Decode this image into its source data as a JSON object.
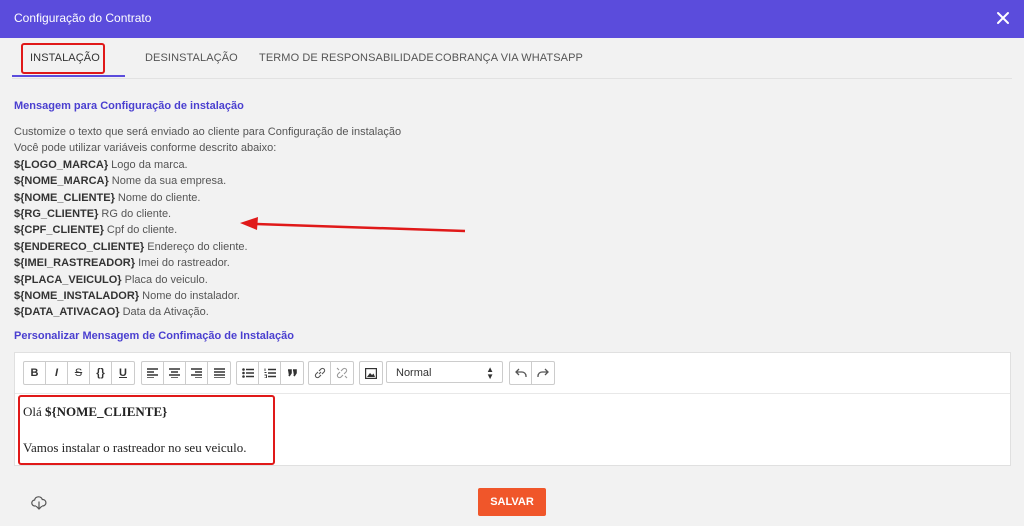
{
  "header": {
    "title": "Configuração do Contrato"
  },
  "tabs": [
    {
      "label": "INSTALAÇÃO"
    },
    {
      "label": "DESINSTALAÇÃO"
    },
    {
      "label": "TERMO DE RESPONSABILIDADE"
    },
    {
      "label": "COBRANÇA VIA WHATSAPP"
    }
  ],
  "section1": {
    "title": "Mensagem para Configuração de instalação",
    "intro1": "Customize o texto que será enviado ao cliente para Configuração de instalação",
    "intro2": "Você pode utilizar variáveis conforme descrito abaixo:",
    "variables": [
      {
        "name": "${LOGO_MARCA}",
        "desc": " Logo da marca."
      },
      {
        "name": "${NOME_MARCA}",
        "desc": " Nome da sua empresa."
      },
      {
        "name": "${NOME_CLIENTE}",
        "desc": " Nome do cliente."
      },
      {
        "name": "${RG_CLIENTE}",
        "desc": " RG do cliente."
      },
      {
        "name": "${CPF_CLIENTE}",
        "desc": " Cpf do cliente."
      },
      {
        "name": "${ENDERECO_CLIENTE}",
        "desc": " Endereço do cliente."
      },
      {
        "name": "${IMEI_RASTREADOR}",
        "desc": " Imei do rastreador."
      },
      {
        "name": "${PLACA_VEICULO}",
        "desc": " Placa do veiculo."
      },
      {
        "name": "${NOME_INSTALADOR}",
        "desc": " Nome do instalador."
      },
      {
        "name": "${DATA_ATIVACAO}",
        "desc": " Data da Ativação."
      }
    ]
  },
  "section2": {
    "title": "Personalizar Mensagem de Confimação de Instalação"
  },
  "toolbar": {
    "bold": "B",
    "italic": "I",
    "strike": "S",
    "code": "{}",
    "underline": "U",
    "format_select": "Normal"
  },
  "editor": {
    "line1_prefix": "Olá ",
    "line1_var": "${NOME_CLIENTE}",
    "line2": "Vamos instalar o rastreador no seu veiculo."
  },
  "footer": {
    "save_label": "SALVAR"
  },
  "colors": {
    "header": "#5b4cdc",
    "accent": "#4a3fd0",
    "save_button": "#f0562a",
    "annotation": "#e01919"
  }
}
